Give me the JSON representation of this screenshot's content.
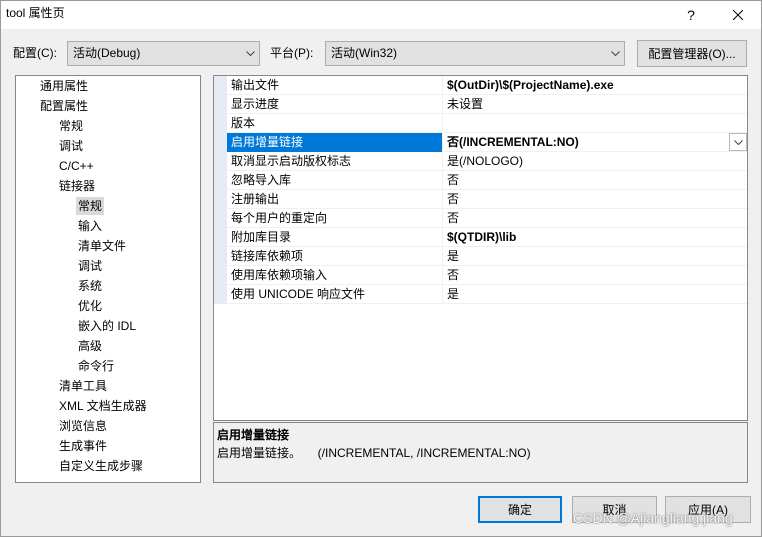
{
  "window": {
    "title": "tool 属性页",
    "help_label": "?"
  },
  "config_bar": {
    "config_label": "配置(C):",
    "config_value": "活动(Debug)",
    "platform_label": "平台(P):",
    "platform_value": "活动(Win32)",
    "manager_button": "配置管理器(O)..."
  },
  "tree": {
    "items": [
      {
        "label": "通用属性"
      },
      {
        "label": "配置属性",
        "expanded": true,
        "children": [
          {
            "label": "常规"
          },
          {
            "label": "调试"
          },
          {
            "label": "C/C++"
          },
          {
            "label": "链接器",
            "expanded": true,
            "children": [
              {
                "label": "常规",
                "selected": true
              },
              {
                "label": "输入"
              },
              {
                "label": "清单文件"
              },
              {
                "label": "调试"
              },
              {
                "label": "系统"
              },
              {
                "label": "优化"
              },
              {
                "label": "嵌入的 IDL"
              },
              {
                "label": "高级"
              },
              {
                "label": "命令行"
              }
            ]
          },
          {
            "label": "清单工具"
          },
          {
            "label": "XML 文档生成器"
          },
          {
            "label": "浏览信息"
          },
          {
            "label": "生成事件"
          },
          {
            "label": "自定义生成步骤"
          }
        ]
      }
    ]
  },
  "properties": {
    "rows": [
      {
        "name": "输出文件",
        "value": "$(OutDir)\\$(ProjectName).exe"
      },
      {
        "name": "显示进度",
        "value": "未设置"
      },
      {
        "name": "版本"
      },
      {
        "name": "启用增量链接",
        "value": "否(/INCREMENTAL:NO)",
        "selected": true
      },
      {
        "name": "取消显示启动版权标志",
        "value": "是(/NOLOGO)"
      },
      {
        "name": "忽略导入库",
        "value": "否"
      },
      {
        "name": "注册输出",
        "value": "否"
      },
      {
        "name": "每个用户的重定向",
        "value": "否"
      },
      {
        "name": "附加库目录",
        "value": "$(QTDIR)\\lib"
      },
      {
        "name": "链接库依赖项",
        "value": "是"
      },
      {
        "name": "使用库依赖项输入",
        "value": "否"
      },
      {
        "name": "使用 UNICODE 响应文件",
        "value": "是"
      }
    ]
  },
  "description": {
    "title": "启用增量链接",
    "text": "启用增量链接。     (/INCREMENTAL, /INCREMENTAL:NO)"
  },
  "buttons": {
    "ok": "确定",
    "cancel": "取消",
    "apply": "应用(A)"
  },
  "watermark": "CSDN @Ajiangliang.jiang",
  "colors": {
    "accent": "#0078d7",
    "selection_inactive": "#d9d9d9",
    "row_margin": "#e6eaf2"
  },
  "icons": {
    "close": "close-icon",
    "help": "help-icon",
    "dropdown": "chevron-down-icon"
  }
}
